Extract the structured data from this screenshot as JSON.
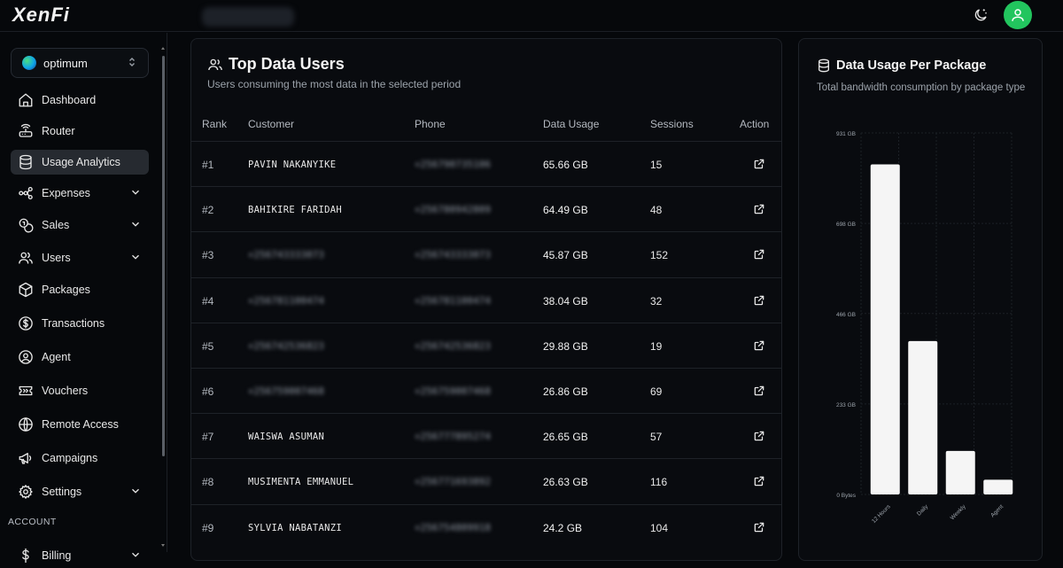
{
  "app": {
    "logo": "XenFi"
  },
  "workspace": {
    "name": "optimum"
  },
  "sidebar": {
    "items": [
      {
        "label": "Dashboard",
        "icon": "home-icon",
        "chevron": false,
        "active": false
      },
      {
        "label": "Router",
        "icon": "router-icon",
        "chevron": false,
        "active": false
      },
      {
        "label": "Usage Analytics",
        "icon": "database-icon",
        "chevron": false,
        "active": true
      },
      {
        "label": "Expenses",
        "icon": "workflow-icon",
        "chevron": true,
        "active": false
      },
      {
        "label": "Sales",
        "icon": "coins-icon",
        "chevron": true,
        "active": false
      },
      {
        "label": "Users",
        "icon": "users-icon",
        "chevron": true,
        "active": false
      },
      {
        "label": "Packages",
        "icon": "package-icon",
        "chevron": false,
        "active": false
      },
      {
        "label": "Transactions",
        "icon": "dollar-circle-icon",
        "chevron": false,
        "active": false
      },
      {
        "label": "Agent",
        "icon": "user-circle-icon",
        "chevron": false,
        "active": false
      },
      {
        "label": "Vouchers",
        "icon": "ticket-icon",
        "chevron": false,
        "active": false
      },
      {
        "label": "Remote Access",
        "icon": "globe-icon",
        "chevron": false,
        "active": false
      },
      {
        "label": "Campaigns",
        "icon": "megaphone-icon",
        "chevron": false,
        "active": false
      },
      {
        "label": "Settings",
        "icon": "gear-icon",
        "chevron": true,
        "active": false
      }
    ],
    "section_account": "ACCOUNT",
    "billing_label": "Billing"
  },
  "top_users": {
    "title": "Top Data Users",
    "subtitle": "Users consuming the most data in the selected period",
    "columns": [
      "Rank",
      "Customer",
      "Phone",
      "Data Usage",
      "Sessions",
      "Action"
    ],
    "rows": [
      {
        "rank": "#1",
        "customer": "PAVIN NAKANYIKE",
        "customer_blurred": false,
        "phone": "+256790735106",
        "usage": "65.66 GB",
        "sessions": "15"
      },
      {
        "rank": "#2",
        "customer": "BAHIKIRE FARIDAH",
        "customer_blurred": false,
        "phone": "+256780942809",
        "usage": "64.49 GB",
        "sessions": "48"
      },
      {
        "rank": "#3",
        "customer": "+256743333073",
        "customer_blurred": true,
        "phone": "+256743333073",
        "usage": "45.87 GB",
        "sessions": "152"
      },
      {
        "rank": "#4",
        "customer": "+256781100474",
        "customer_blurred": true,
        "phone": "+256781100474",
        "usage": "38.04 GB",
        "sessions": "32"
      },
      {
        "rank": "#5",
        "customer": "+256742536823",
        "customer_blurred": true,
        "phone": "+256742536823",
        "usage": "29.88 GB",
        "sessions": "19"
      },
      {
        "rank": "#6",
        "customer": "+256759007468",
        "customer_blurred": true,
        "phone": "+256759007468",
        "usage": "26.86 GB",
        "sessions": "69"
      },
      {
        "rank": "#7",
        "customer": "WAISWA ASUMAN",
        "customer_blurred": false,
        "phone": "+256777895274",
        "usage": "26.65 GB",
        "sessions": "57"
      },
      {
        "rank": "#8",
        "customer": "MUSIMENTA EMMANUEL",
        "customer_blurred": false,
        "phone": "+256771693892",
        "usage": "26.63 GB",
        "sessions": "116"
      },
      {
        "rank": "#9",
        "customer": "SYLVIA NABATANZI",
        "customer_blurred": false,
        "phone": "+256754809918",
        "usage": "24.2 GB",
        "sessions": "104"
      }
    ]
  },
  "package_chart": {
    "title": "Data Usage Per Package",
    "subtitle": "Total bandwidth consumption by package type"
  },
  "chart_data": {
    "type": "bar",
    "categories": [
      "12 Hours",
      "Daily",
      "Weekly",
      "Agent"
    ],
    "values": [
      850,
      395,
      112,
      38
    ],
    "unit": "GB",
    "ylim": [
      0,
      931
    ],
    "yticks": [
      0,
      233,
      466,
      698,
      931
    ],
    "ytick_labels": [
      "0 Bytes",
      "233 GB",
      "466 GB",
      "698 GB",
      "931 GB"
    ],
    "grid": true,
    "bar_color": "#f5f5f5"
  },
  "colors": {
    "accent_green": "#22c55e",
    "active_nav": "#262a30"
  }
}
